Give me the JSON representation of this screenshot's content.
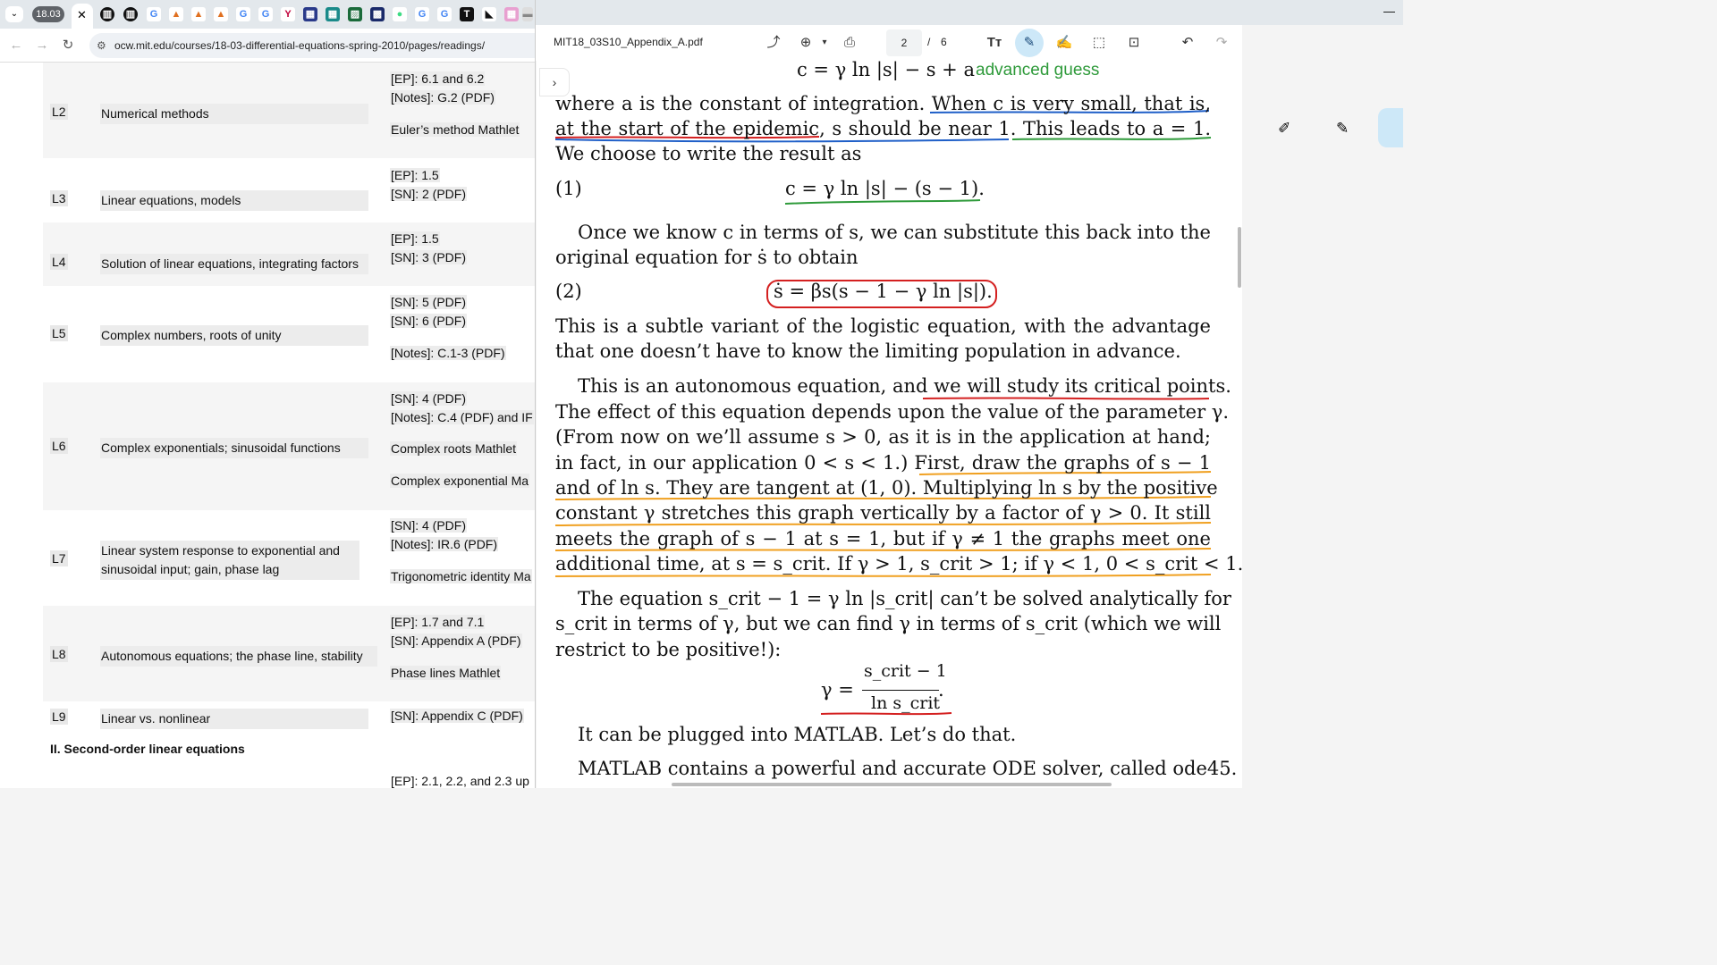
{
  "browser": {
    "tab_time": "18.03",
    "url": "ocw.mit.edu/courses/18-03-differential-equations-spring-2010/pages/readings/"
  },
  "readings": {
    "rows": [
      {
        "lec": "L2",
        "topic": "Numerical methods",
        "reads": [
          "[EP]: 6.1 and 6.2",
          "[Notes]: G.2 (PDF)",
          "Euler’s method Mathlet"
        ]
      },
      {
        "lec": "L3",
        "topic": "Linear equations, models",
        "reads": [
          "[EP]: 1.5",
          "[SN]: 2 (PDF)"
        ]
      },
      {
        "lec": "L4",
        "topic": "Solution of linear equations, integrating factors",
        "reads": [
          "[EP]: 1.5",
          "[SN]: 3 (PDF)"
        ]
      },
      {
        "lec": "L5",
        "topic": "Complex numbers, roots of unity",
        "reads": [
          "[SN]: 5 (PDF)",
          "[SN]: 6 (PDF)",
          "[Notes]: C.1-3 (PDF)"
        ]
      },
      {
        "lec": "L6",
        "topic": "Complex exponentials; sinusoidal functions",
        "reads": [
          "[SN]: 4 (PDF)",
          "[Notes]: C.4 (PDF) and IF",
          "Complex roots Mathlet",
          "Complex exponential Ma"
        ]
      },
      {
        "lec": "L7",
        "topic": "Linear system response to exponential and sinusoidal input; gain, phase lag",
        "reads": [
          "[SN]: 4 (PDF)",
          "[Notes]: IR.6 (PDF)",
          "Trigonometric identity Ma"
        ]
      },
      {
        "lec": "L8",
        "topic": "Autonomous equations; the phase line, stability",
        "reads": [
          "[EP]: 1.7 and 7.1",
          "[SN]: Appendix A (PDF)",
          "Phase lines Mathlet"
        ]
      },
      {
        "lec": "L9",
        "topic": "Linear vs. nonlinear",
        "reads": [
          "[SN]: Appendix C (PDF)"
        ]
      }
    ],
    "section": "II. Second-order linear equations",
    "next_read": "[EP]: 2.1, 2.2, and 2.3 up"
  },
  "pdf": {
    "filename": "MIT18_03S10_Appendix_A.pdf",
    "page_current": "2",
    "page_total": "6",
    "lines": {
      "l0_eq": "c = γ ln |s| − s + a",
      "l0_note": "advanced guess",
      "l1": "where a is the constant of integration. When c is very small, that is,",
      "l2": "at the start of the epidemic, s should be near 1. This leads to a = 1.",
      "l3": "We choose to write the result as",
      "eq1_label": "(1)",
      "eq1": "c = γ ln |s| − (s − 1).",
      "l4": "Once we know c in terms of s, we can substitute this back into the",
      "l5": "original equation for ṡ to obtain",
      "eq2_label": "(2)",
      "eq2": "ṡ = βs(s − 1 − γ ln |s|).",
      "l6": "This is a subtle variant of the logistic equation, with the advantage",
      "l7": "that one doesn’t have to know the limiting population in advance.",
      "l8": "This is an autonomous equation, and we will study its critical points.",
      "l9": "The effect of this equation depends upon the value of the parameter γ.",
      "l10": "(From now on we’ll assume s > 0, as it is in the application at hand;",
      "l11": "in fact, in our application 0 < s < 1.) First, draw the graphs of s − 1",
      "l12": "and of ln s. They are tangent at (1, 0). Multiplying ln s by the positive",
      "l13": "constant γ stretches this graph vertically by a factor of γ > 0. It still",
      "l14": "meets the graph of s − 1 at s = 1, but if γ ≠ 1 the graphs meet one",
      "l15": "additional time, at s = s_crit. If γ > 1, s_crit > 1; if γ < 1, 0 < s_crit < 1.",
      "l16": "The equation s_crit − 1 = γ ln |s_crit| can’t be solved analytically for",
      "l17": "s_crit in terms of γ, but we can find γ in terms of s_crit (which we will",
      "l18": "restrict to be positive!):",
      "eq3_lhs": "γ =",
      "eq3_num": "s_crit − 1",
      "eq3_den": "ln s_crit",
      "eq3_end": ".",
      "l19": "It can be plugged into MATLAB. Let’s do that.",
      "l20": "MATLAB contains a powerful and accurate ODE solver, called ode45."
    }
  },
  "colors": {
    "red": "#d42020",
    "blue": "#1f5fc8",
    "green": "#2e9a3a",
    "orange": "#f0a020",
    "highlight": "#cde8f8"
  }
}
